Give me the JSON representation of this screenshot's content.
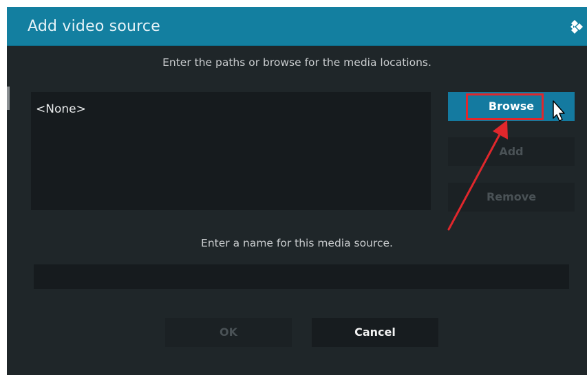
{
  "dialog": {
    "title": "Add video source",
    "logo_icon": "kodi-logo-icon"
  },
  "paths": {
    "instruction": "Enter the paths or browse for the media locations.",
    "items": [
      "<None>"
    ]
  },
  "buttons": {
    "browse": "Browse",
    "add": "Add",
    "remove": "Remove",
    "ok": "OK",
    "cancel": "Cancel"
  },
  "name": {
    "instruction": "Enter a name for this media source.",
    "value": ""
  },
  "annotation": {
    "highlight_color": "#e0272c",
    "arrow_icon": "red-arrow-icon",
    "cursor_icon": "mouse-pointer-icon"
  },
  "colors": {
    "accent": "#137fa0",
    "background": "#1f2629"
  }
}
